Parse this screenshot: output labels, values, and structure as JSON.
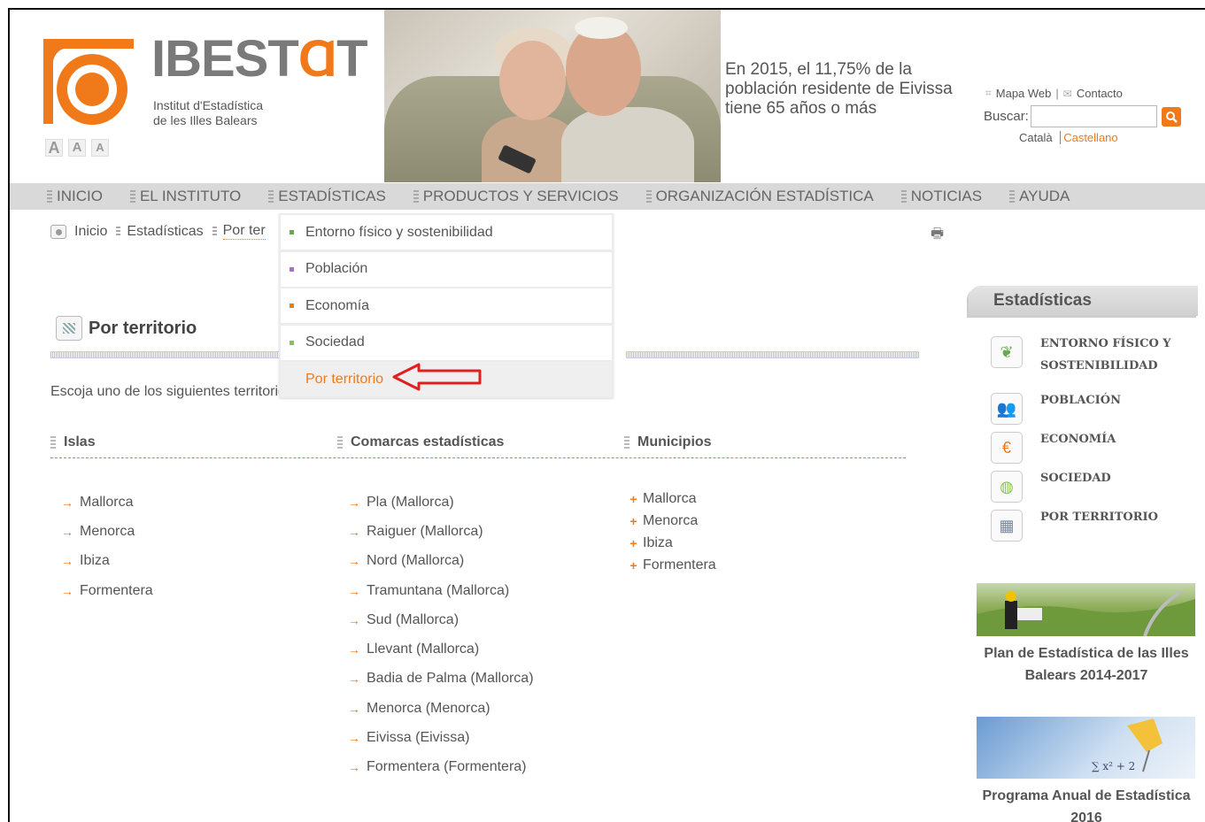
{
  "header": {
    "logo_name": "IBESTAT",
    "logo_subtitle_line1": "Institut d'Estadística",
    "logo_subtitle_line2": "de les Illes Balears",
    "font_size_buttons": [
      "A",
      "A",
      "A"
    ],
    "banner_text": "En 2015, el 11,75% de la población residente de Eivissa tiene 65 años o más",
    "links": {
      "site_map": "Mapa Web",
      "separator": "|",
      "contact": "Contacto"
    },
    "search": {
      "label": "Buscar:",
      "value": "",
      "placeholder": ""
    },
    "languages": {
      "catalan": "Català",
      "spanish": "Castellano",
      "active": "Castellano"
    }
  },
  "topnav": {
    "items": [
      "INICIO",
      "EL INSTITUTO",
      "ESTADÍSTICAS",
      "PRODUCTOS Y SERVICIOS",
      "ORGANIZACIÓN ESTADÍSTICA",
      "NOTICIAS",
      "AYUDA"
    ]
  },
  "breadcrumb": {
    "home": "Inicio",
    "section": "Estadísticas",
    "current": "Por ter"
  },
  "dropdown": {
    "items": [
      {
        "label": "Entorno físico y sostenibilidad",
        "color": "#6aa84f"
      },
      {
        "label": "Población",
        "color": "#a673c4"
      },
      {
        "label": "Economía",
        "color": "#f07a1a"
      },
      {
        "label": "Sociedad",
        "color": "#8bc34a"
      },
      {
        "label": "Por territorio",
        "color": ""
      }
    ]
  },
  "main": {
    "title": "Por territorio",
    "intro": "Escoja uno de los siguientes territorios:",
    "columns": [
      {
        "heading": "Islas",
        "items": [
          "Mallorca",
          "Menorca",
          "Ibiza",
          "Formentera"
        ]
      },
      {
        "heading": "Comarcas estadísticas",
        "items": [
          "Pla (Mallorca)",
          "Raiguer (Mallorca)",
          "Nord (Mallorca)",
          "Tramuntana (Mallorca)",
          "Sud (Mallorca)",
          "Llevant (Mallorca)",
          "Badia de Palma (Mallorca)",
          "Menorca (Menorca)",
          "Eivissa (Eivissa)",
          "Formentera (Formentera)"
        ]
      },
      {
        "heading": "Municipios",
        "items": [
          "Mallorca",
          "Menorca",
          "Ibiza",
          "Formentera"
        ]
      }
    ]
  },
  "sidebar": {
    "title": "Estadísticas",
    "items": [
      {
        "label": "ENTORNO FÍSICO Y SOSTENIBILIDAD",
        "icon": "leaf-icon"
      },
      {
        "label": "POBLACIÓN",
        "icon": "people-icon"
      },
      {
        "label": "ECONOMÍA",
        "icon": "euro-icon"
      },
      {
        "label": "SOCIEDAD",
        "icon": "globe-icon"
      },
      {
        "label": "POR TERRITORIO",
        "icon": "map-icon"
      }
    ],
    "promos": [
      {
        "caption": "Plan de Estadística de las Illes Balears 2014-2017"
      },
      {
        "caption": "Programa Anual de Estadística 2016"
      }
    ]
  },
  "colors": {
    "accent": "#f07a1a",
    "nav_bg": "#d9d9d9",
    "text": "#555555",
    "arrow": "#e02020"
  }
}
